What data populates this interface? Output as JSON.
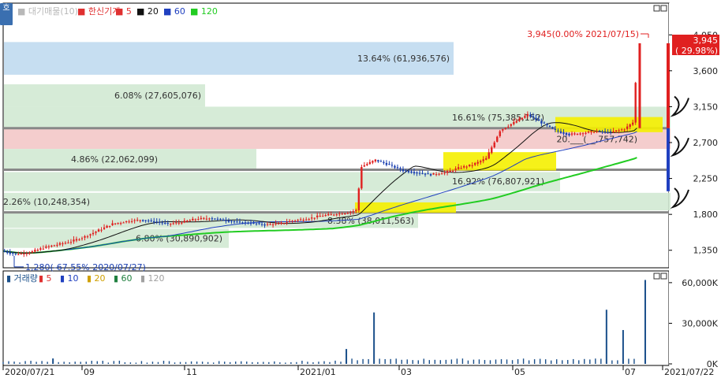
{
  "side_button": "호",
  "price_panel": {
    "legend": [
      {
        "text": "■ 대기매물(10)",
        "color": "#b8b8b8"
      },
      {
        "text": "■ 한신기계",
        "color": "#e03030"
      },
      {
        "text": "■ 5",
        "color": "#e03030"
      },
      {
        "text": "■ 20",
        "color": "#111111"
      },
      {
        "text": "■ 60",
        "color": "#2040c0"
      },
      {
        "text": "■ 120",
        "color": "#22cc22"
      }
    ],
    "y_ticks": [
      "4,050",
      "3,600",
      "3,150",
      "2,700",
      "2,250",
      "1,800",
      "1,350"
    ],
    "current_price": "3,945",
    "current_change": "( 29.98%)",
    "max_label": "3,945(0.00% 2021/07/15)",
    "min_label": "1,280(-67.55% 2020/07/27)",
    "band_labels": [
      "13.64% (61,936,576)",
      "6.08% (27,605,076)",
      "16.61% (75,385,152)",
      "4.86% (22,062,099)",
      "2.26% (10,248,354)",
      "16.92% (76,807,921)",
      "20.___(__,757,742)",
      "8.38% (38,011,563)",
      "6.80% (30,890,902)"
    ]
  },
  "volume_panel": {
    "legend": [
      {
        "text": "▮ 거래량",
        "color": "#1a4f8a"
      },
      {
        "text": "▮ 5",
        "color": "#e03030"
      },
      {
        "text": "▮ 10",
        "color": "#2040c0"
      },
      {
        "text": "▮ 20",
        "color": "#d0a000"
      },
      {
        "text": "▮ 60",
        "color": "#208040"
      },
      {
        "text": "▮ 120",
        "color": "#a0a0a0"
      }
    ],
    "y_ticks": [
      "60,000K",
      "30,000K",
      "0K"
    ]
  },
  "x_labels": [
    "2020/07/21",
    "09",
    "11",
    "2021/01",
    "03",
    "05",
    "07",
    "2021/07/22"
  ],
  "chart_data": {
    "type": "candlestick",
    "x_range": [
      "2020/07/21",
      "2021/07/22"
    ],
    "y_range": [
      1150,
      4250
    ],
    "volume_range": [
      0,
      64000
    ],
    "current_price": 3945,
    "max_price": {
      "value": 3945,
      "date": "2021/07/15"
    },
    "min_price": {
      "value": 1280,
      "date": "2020/07/27"
    },
    "support_resistance_lines": [
      2880,
      2360,
      1825
    ],
    "volume_profile": [
      {
        "low": 3550,
        "high": 3960,
        "label": "13.64% (61,936,576)",
        "color": "#bcd8ee"
      },
      {
        "low": 3150,
        "high": 3430,
        "label": "6.08% (27,605,076)",
        "color": "#cfe8d0"
      },
      {
        "low": 2880,
        "high": 3150,
        "label": "16.61% (75,385,152)",
        "color": "#cfe8d0"
      },
      {
        "low": 2620,
        "high": 2880,
        "label": "20.___(__,757,742)",
        "color": "#f2c4c4"
      },
      {
        "low": 2370,
        "high": 2620,
        "label": "4.86% (22,062,099)",
        "color": "#cfe8d0"
      },
      {
        "low": 2090,
        "high": 2330,
        "label": "16.92% (76,807,921)",
        "color": "#cfe8d0"
      },
      {
        "low": 1850,
        "high": 2070,
        "label": "2.26% (10,248,354)",
        "color": "#cfe8d0"
      },
      {
        "low": 1630,
        "high": 1820,
        "label": "8.38% (38,011,563)",
        "color": "#cfe8d0"
      },
      {
        "low": 1380,
        "high": 1620,
        "label": "6.80% (30,890,902)",
        "color": "#cfe8d0"
      }
    ],
    "price_path": [
      [
        0,
        1340
      ],
      [
        5,
        1300
      ],
      [
        10,
        1320
      ],
      [
        15,
        1380
      ],
      [
        20,
        1420
      ],
      [
        25,
        1460
      ],
      [
        30,
        1520
      ],
      [
        35,
        1600
      ],
      [
        40,
        1680
      ],
      [
        45,
        1710
      ],
      [
        50,
        1730
      ],
      [
        55,
        1710
      ],
      [
        60,
        1680
      ],
      [
        65,
        1700
      ],
      [
        70,
        1740
      ],
      [
        75,
        1750
      ],
      [
        80,
        1730
      ],
      [
        85,
        1700
      ],
      [
        90,
        1690
      ],
      [
        95,
        1670
      ],
      [
        100,
        1680
      ],
      [
        105,
        1720
      ],
      [
        110,
        1740
      ],
      [
        115,
        1780
      ],
      [
        120,
        1800
      ],
      [
        125,
        1820
      ],
      [
        128,
        1850
      ],
      [
        130,
        2400
      ],
      [
        135,
        2480
      ],
      [
        140,
        2420
      ],
      [
        145,
        2350
      ],
      [
        150,
        2320
      ],
      [
        155,
        2300
      ],
      [
        160,
        2320
      ],
      [
        165,
        2380
      ],
      [
        170,
        2420
      ],
      [
        175,
        2500
      ],
      [
        180,
        2850
      ],
      [
        185,
        2950
      ],
      [
        190,
        3050
      ],
      [
        195,
        2950
      ],
      [
        200,
        2850
      ],
      [
        205,
        2800
      ],
      [
        210,
        2820
      ],
      [
        215,
        2840
      ],
      [
        220,
        2830
      ],
      [
        225,
        2870
      ],
      [
        228,
        2950
      ],
      [
        230,
        3945
      ],
      [
        232,
        3945
      ]
    ],
    "volume_spikes": [
      [
        18,
        4000
      ],
      [
        124,
        11000
      ],
      [
        134,
        38000
      ],
      [
        218,
        40000
      ],
      [
        224,
        25000
      ],
      [
        232,
        62000
      ]
    ]
  }
}
